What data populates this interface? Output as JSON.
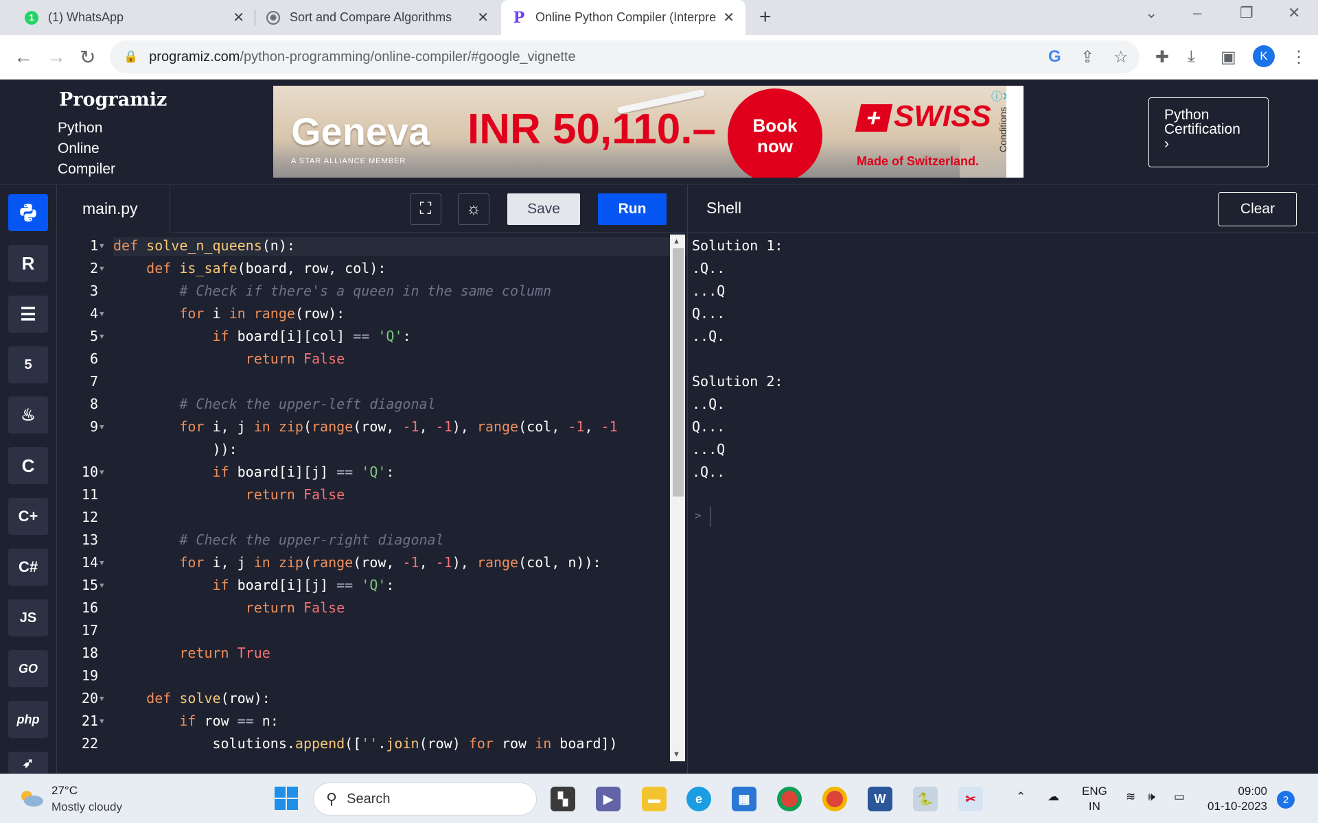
{
  "browser": {
    "tabs": [
      {
        "title": "(1) WhatsApp",
        "badge": "1"
      },
      {
        "title": "Sort and Compare Algorithms"
      },
      {
        "title": "Online Python Compiler (Interpre"
      }
    ],
    "url_domain": "programiz.com",
    "url_path": "/python-programming/online-compiler/#google_vignette",
    "profile_initial": "K"
  },
  "site": {
    "logo": "Programiz",
    "subtitle_lines": [
      "Python",
      "Online",
      "Compiler"
    ],
    "certification_lines": [
      "Python",
      "Certification",
      "›"
    ]
  },
  "ad": {
    "city": "Geneva",
    "price": "INR 50,110.–",
    "book_lines": [
      "Book",
      "now"
    ],
    "brand": "SWISS",
    "tagline": "Made of Switzerland.",
    "member": "A STAR ALLIANCE MEMBER",
    "conditions": "Conditions"
  },
  "sidebar": {
    "languages": [
      "python-icon",
      "r-icon",
      "sql-icon",
      "html-icon",
      "java-icon",
      "c-icon",
      "cpp-icon",
      "csharp-icon",
      "JS",
      "GO",
      "php",
      "swift-icon"
    ]
  },
  "editor": {
    "filename": "main.py",
    "save_label": "Save",
    "run_label": "Run",
    "line_numbers": [
      "1",
      "2",
      "3",
      "4",
      "5",
      "6",
      "7",
      "8",
      "9",
      "",
      "10",
      "11",
      "12",
      "13",
      "14",
      "15",
      "16",
      "17",
      "18",
      "19",
      "20",
      "21",
      "22"
    ]
  },
  "shell": {
    "title": "Shell",
    "clear_label": "Clear",
    "output": [
      "Solution 1:",
      ".Q..",
      "...Q",
      "Q...",
      "..Q.",
      "",
      "Solution 2:",
      "..Q.",
      "Q...",
      "...Q",
      ".Q.."
    ],
    "prompt": ">"
  },
  "taskbar": {
    "temperature": "27°C",
    "weather": "Mostly cloudy",
    "search_placeholder": "Search",
    "lang_top": "ENG",
    "lang_bottom": "IN",
    "time": "09:00",
    "date": "01-10-2023",
    "notifications": "2"
  }
}
